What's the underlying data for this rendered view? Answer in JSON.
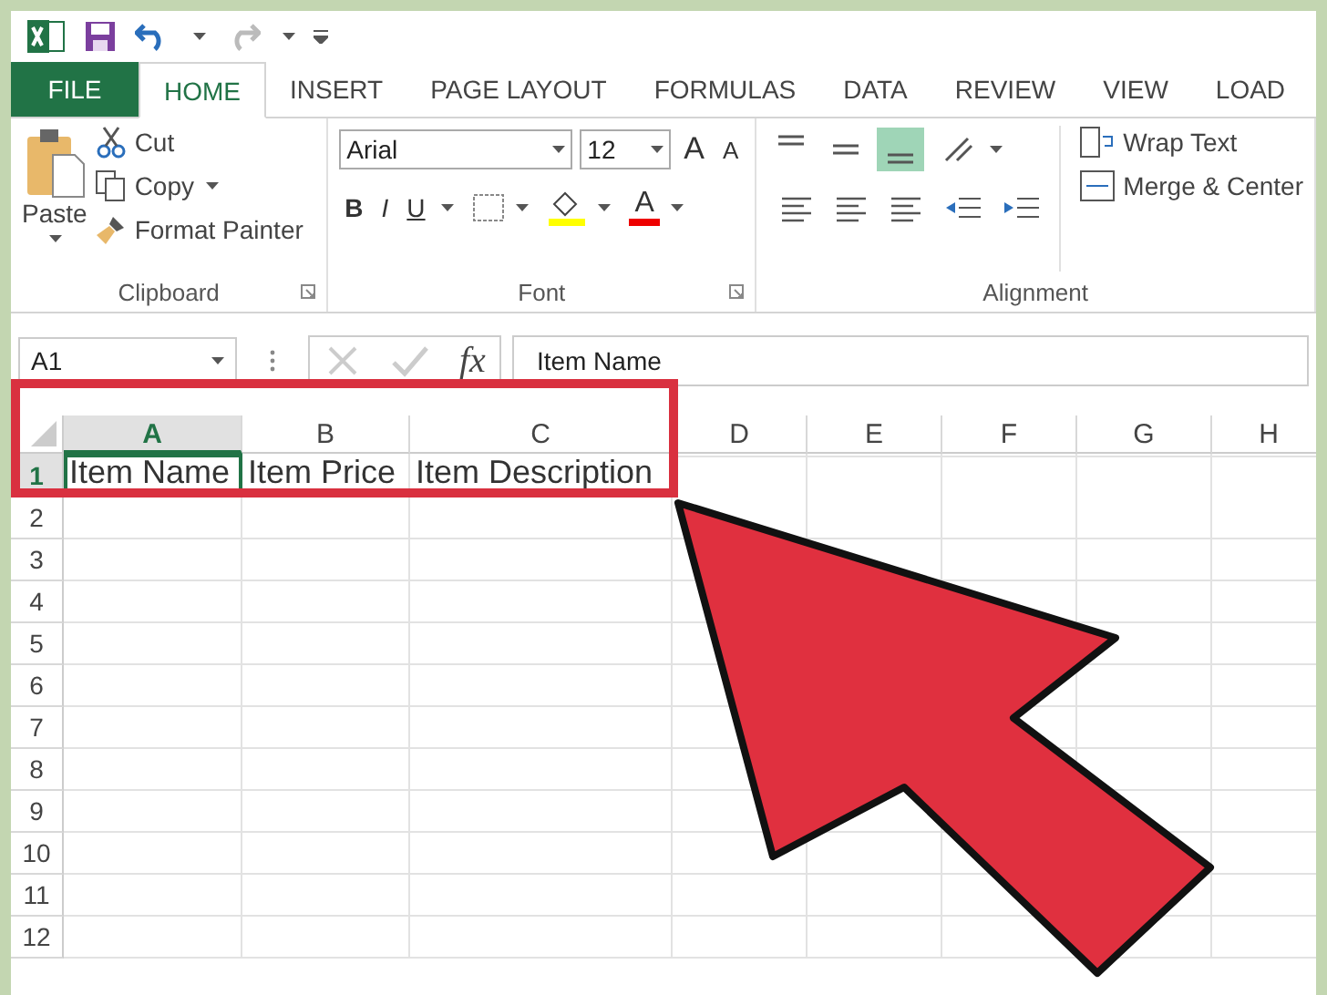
{
  "tabs": [
    {
      "label": "FILE",
      "kind": "file",
      "selected": false
    },
    {
      "label": "HOME",
      "kind": "tab",
      "selected": true
    },
    {
      "label": "INSERT",
      "kind": "tab",
      "selected": false
    },
    {
      "label": "PAGE LAYOUT",
      "kind": "tab",
      "selected": false
    },
    {
      "label": "FORMULAS",
      "kind": "tab",
      "selected": false
    },
    {
      "label": "DATA",
      "kind": "tab",
      "selected": false
    },
    {
      "label": "REVIEW",
      "kind": "tab",
      "selected": false
    },
    {
      "label": "VIEW",
      "kind": "tab",
      "selected": false
    },
    {
      "label": "LOAD",
      "kind": "tab",
      "selected": false
    }
  ],
  "clipboard": {
    "paste": "Paste",
    "cut": "Cut",
    "copy": "Copy",
    "format_painter": "Format Painter",
    "label": "Clipboard"
  },
  "font": {
    "name": "Arial",
    "size": "12",
    "grow": "A",
    "shrink": "A",
    "bold": "B",
    "italic": "I",
    "underline": "U",
    "font_color": "A",
    "label": "Font"
  },
  "alignment": {
    "vertical": [
      {
        "selected": false
      },
      {
        "selected": false
      },
      {
        "selected": true
      }
    ],
    "wrap_text": "Wrap Text",
    "merge_center": "Merge & Center",
    "label": "Alignment"
  },
  "formula_bar": {
    "name_box": "A1",
    "fx": "fx",
    "value": "Item Name"
  },
  "columns": [
    {
      "label": "A",
      "selected": true
    },
    {
      "label": "B",
      "selected": false
    },
    {
      "label": "C",
      "selected": false
    },
    {
      "label": "D",
      "selected": false
    },
    {
      "label": "E",
      "selected": false
    },
    {
      "label": "F",
      "selected": false
    },
    {
      "label": "G",
      "selected": false
    },
    {
      "label": "H",
      "selected": false
    }
  ],
  "rows": [
    {
      "label": "1",
      "selected": true,
      "cells": [
        "Item Name",
        "Item Price",
        "Item Description"
      ]
    },
    {
      "label": "2",
      "selected": false,
      "cells": []
    },
    {
      "label": "3",
      "selected": false,
      "cells": []
    },
    {
      "label": "4",
      "selected": false,
      "cells": []
    },
    {
      "label": "5",
      "selected": false,
      "cells": []
    },
    {
      "label": "6",
      "selected": false,
      "cells": []
    },
    {
      "label": "7",
      "selected": false,
      "cells": []
    },
    {
      "label": "8",
      "selected": false,
      "cells": []
    },
    {
      "label": "9",
      "selected": false,
      "cells": []
    },
    {
      "label": "10",
      "selected": false,
      "cells": []
    },
    {
      "label": "11",
      "selected": false,
      "cells": []
    },
    {
      "label": "12",
      "selected": false,
      "cells": []
    }
  ]
}
